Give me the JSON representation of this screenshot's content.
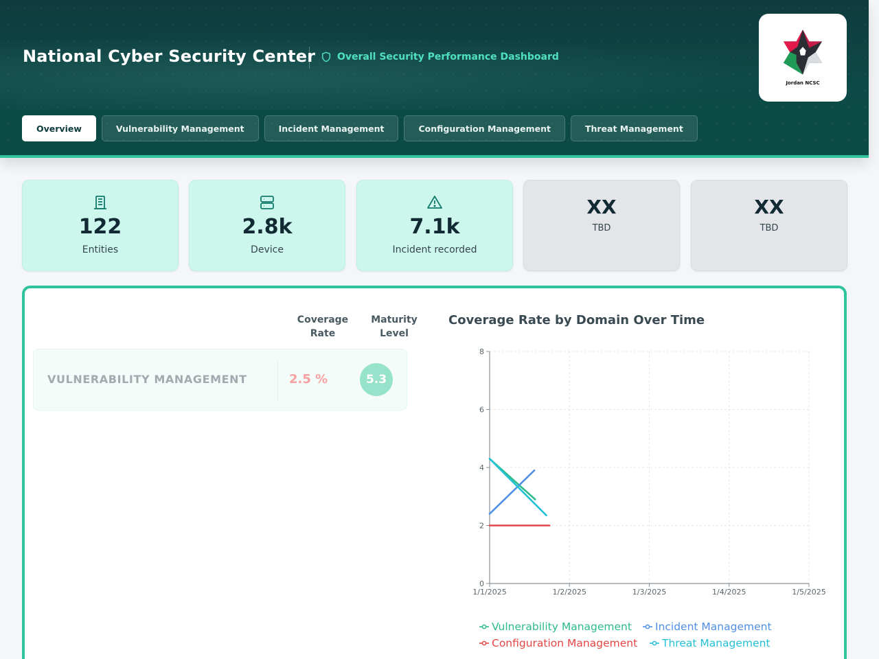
{
  "header": {
    "title": "National Cyber Security Center",
    "subtitle": "Overall Security Performance Dashboard",
    "logo_text": "Jordan NCSC"
  },
  "tabs": [
    {
      "label": "Overview",
      "active": true
    },
    {
      "label": "Vulnerability Management",
      "active": false
    },
    {
      "label": "Incident Management",
      "active": false
    },
    {
      "label": "Configuration Management",
      "active": false
    },
    {
      "label": "Threat Management",
      "active": false
    }
  ],
  "stats": [
    {
      "value": "122",
      "label": "Entities",
      "icon": "building-icon"
    },
    {
      "value": "2.8k",
      "label": "Device",
      "icon": "server-icon"
    },
    {
      "value": "7.1k",
      "label": "Incident recorded",
      "icon": "warning-icon"
    },
    {
      "value": "XX",
      "label": "TBD"
    },
    {
      "value": "XX",
      "label": "TBD"
    }
  ],
  "table": {
    "col_coverage": "Coverage\nRate",
    "col_maturity": "Maturity\nLevel",
    "rows": [
      {
        "domain": "VULNERABILITY MANAGEMENT",
        "coverage": "2.5 %",
        "maturity": "5.3"
      }
    ]
  },
  "colors": {
    "accent": "#2fc49d",
    "vulnerability": "#2dbb8a",
    "incident": "#4f8fe6",
    "configuration": "#e64545",
    "threat": "#22c1d6"
  },
  "chart_data": {
    "type": "line",
    "title": "Coverage Rate by Domain Over Time",
    "xlabel": "",
    "ylabel": "",
    "x_ticks": [
      "1/1/2025",
      "1/2/2025",
      "1/3/2025",
      "1/4/2025",
      "1/5/2025"
    ],
    "xlim": [
      0,
      4
    ],
    "ylim": [
      0,
      8
    ],
    "y_ticks": [
      0,
      2,
      4,
      6,
      8
    ],
    "grid": true,
    "legend_position": "bottom",
    "series": [
      {
        "name": "Vulnerability Management",
        "color": "#2dbb8a",
        "x": [
          0,
          0.57
        ],
        "y": [
          4.3,
          2.9
        ]
      },
      {
        "name": "Incident Management",
        "color": "#4f8fe6",
        "x": [
          0,
          0.56
        ],
        "y": [
          2.4,
          3.9
        ]
      },
      {
        "name": "Configuration Management",
        "color": "#e64545",
        "x": [
          0,
          0.75
        ],
        "y": [
          2.0,
          2.0
        ]
      },
      {
        "name": "Threat Management",
        "color": "#22c1d6",
        "x": [
          0,
          0.71
        ],
        "y": [
          4.3,
          2.35
        ]
      }
    ]
  }
}
